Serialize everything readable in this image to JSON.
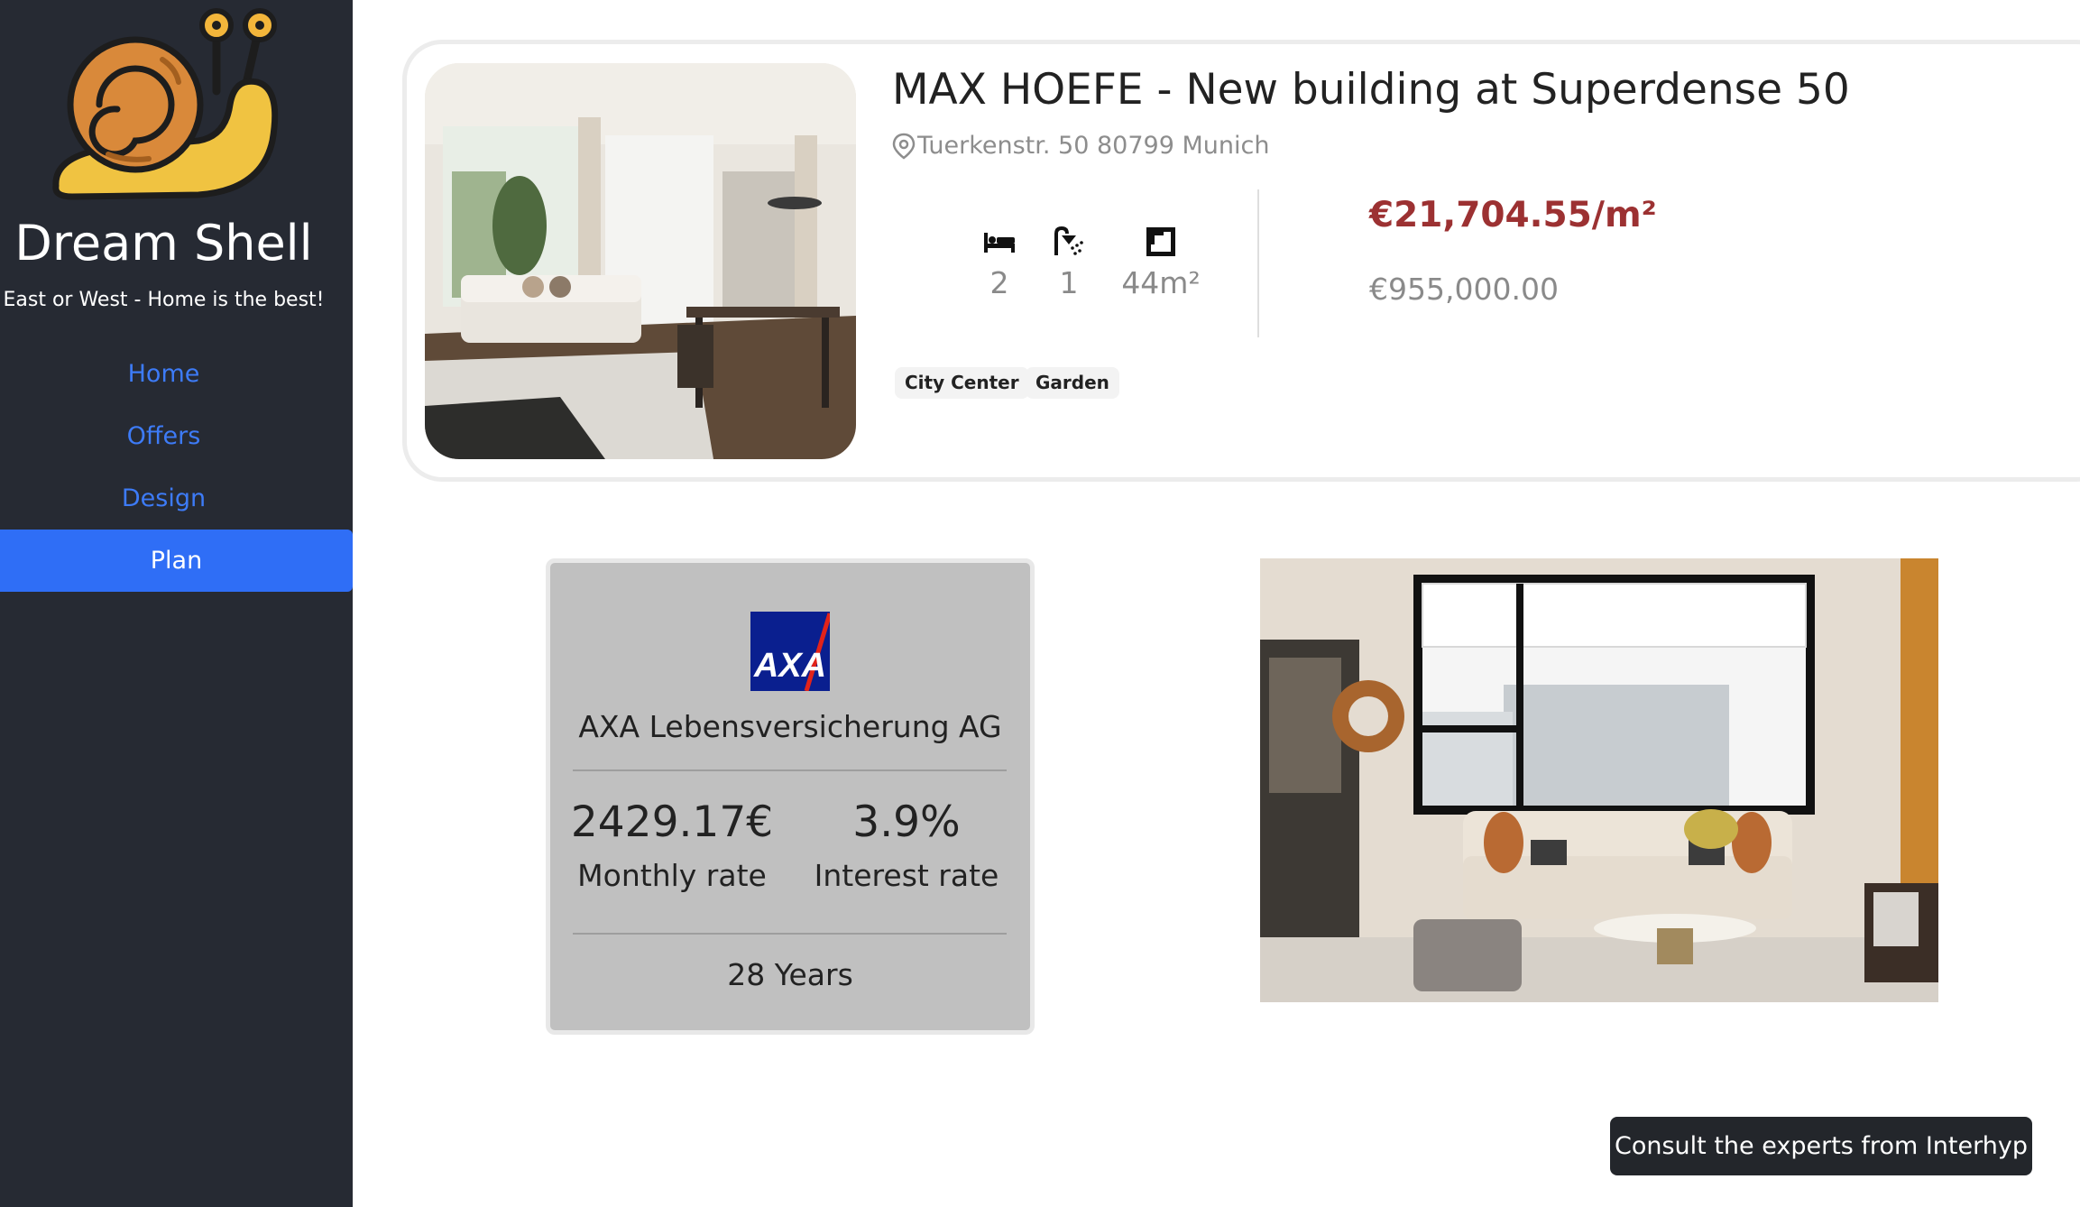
{
  "sidebar": {
    "brand": "Dream Shell",
    "tagline": "East or West - Home is the best!",
    "logo_icon": "snail-logo-icon",
    "nav": [
      {
        "label": "Home",
        "active": false
      },
      {
        "label": "Offers",
        "active": false
      },
      {
        "label": "Design",
        "active": false
      },
      {
        "label": "Plan",
        "active": true
      }
    ]
  },
  "listing": {
    "title": "MAX HOEFE - New building at Superdense 50",
    "address": "Tuerkenstr. 50 80799 Munich",
    "bedrooms": "2",
    "bathrooms": "1",
    "area": "44m²",
    "price_per_m2": "€21,704.55/m²",
    "price": "€955,000.00",
    "tags": [
      "City Center",
      "Garden"
    ],
    "icons": {
      "bedrooms": "bed-icon",
      "bathrooms": "shower-icon",
      "area": "floorplan-icon",
      "address": "location-pin-icon"
    }
  },
  "loan": {
    "lender_logo": "AXA",
    "lender": "AXA Lebensversicherung AG",
    "monthly_rate": "2429.17€",
    "monthly_rate_label": "Monthly rate",
    "interest_rate": "3.9%",
    "interest_rate_label": "Interest rate",
    "term": "28 Years"
  },
  "cta": {
    "label": "Consult the experts from Interhyp"
  },
  "colors": {
    "sidebar_bg": "#262a33",
    "accent": "#2f6ef6",
    "price_red": "#9c3132",
    "loan_bg": "#c0c0c0"
  }
}
